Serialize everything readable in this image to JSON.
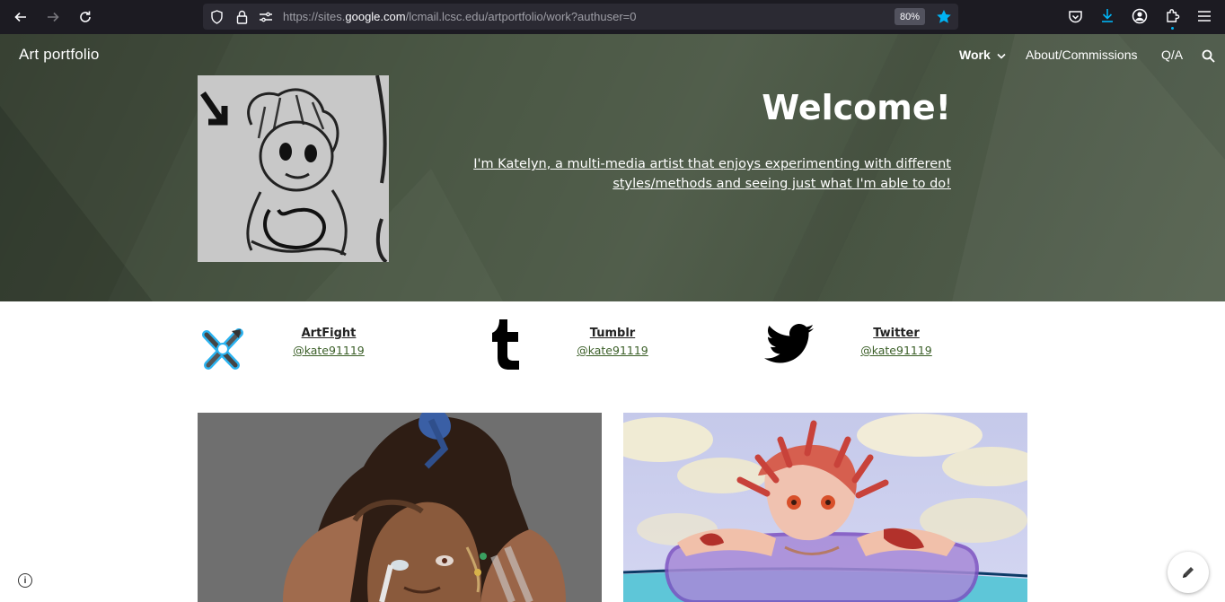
{
  "browser": {
    "url_prefix": "https://sites.",
    "url_domain": "google.com",
    "url_suffix": "/lcmail.lcsc.edu/artportfolio/work?authuser=0",
    "zoom": "80%"
  },
  "site": {
    "title": "Art portfolio",
    "nav": [
      "Work",
      "About/Commissions",
      "Q/A"
    ]
  },
  "hero": {
    "heading": "Welcome!",
    "intro": "I'm Katelyn, a multi-media artist that enjoys experimenting with different styles/methods and seeing just what I'm able to do!"
  },
  "social": [
    {
      "name": "ArtFight",
      "handle": "@kate91119 "
    },
    {
      "name": "Tumblr",
      "handle": "@kate91119 "
    },
    {
      "name": "Twitter",
      "handle": "@kate91119 "
    }
  ],
  "colors": {
    "hero_bg": "#4c5946",
    "browser_bg": "#1c1b22",
    "link_green": "#3b5f28"
  },
  "icons": {
    "back": "arrow-left-icon",
    "forward": "arrow-right-icon",
    "reload": "reload-icon",
    "bookmark": "star-icon",
    "search": "search-icon",
    "edit": "pencil-icon"
  }
}
